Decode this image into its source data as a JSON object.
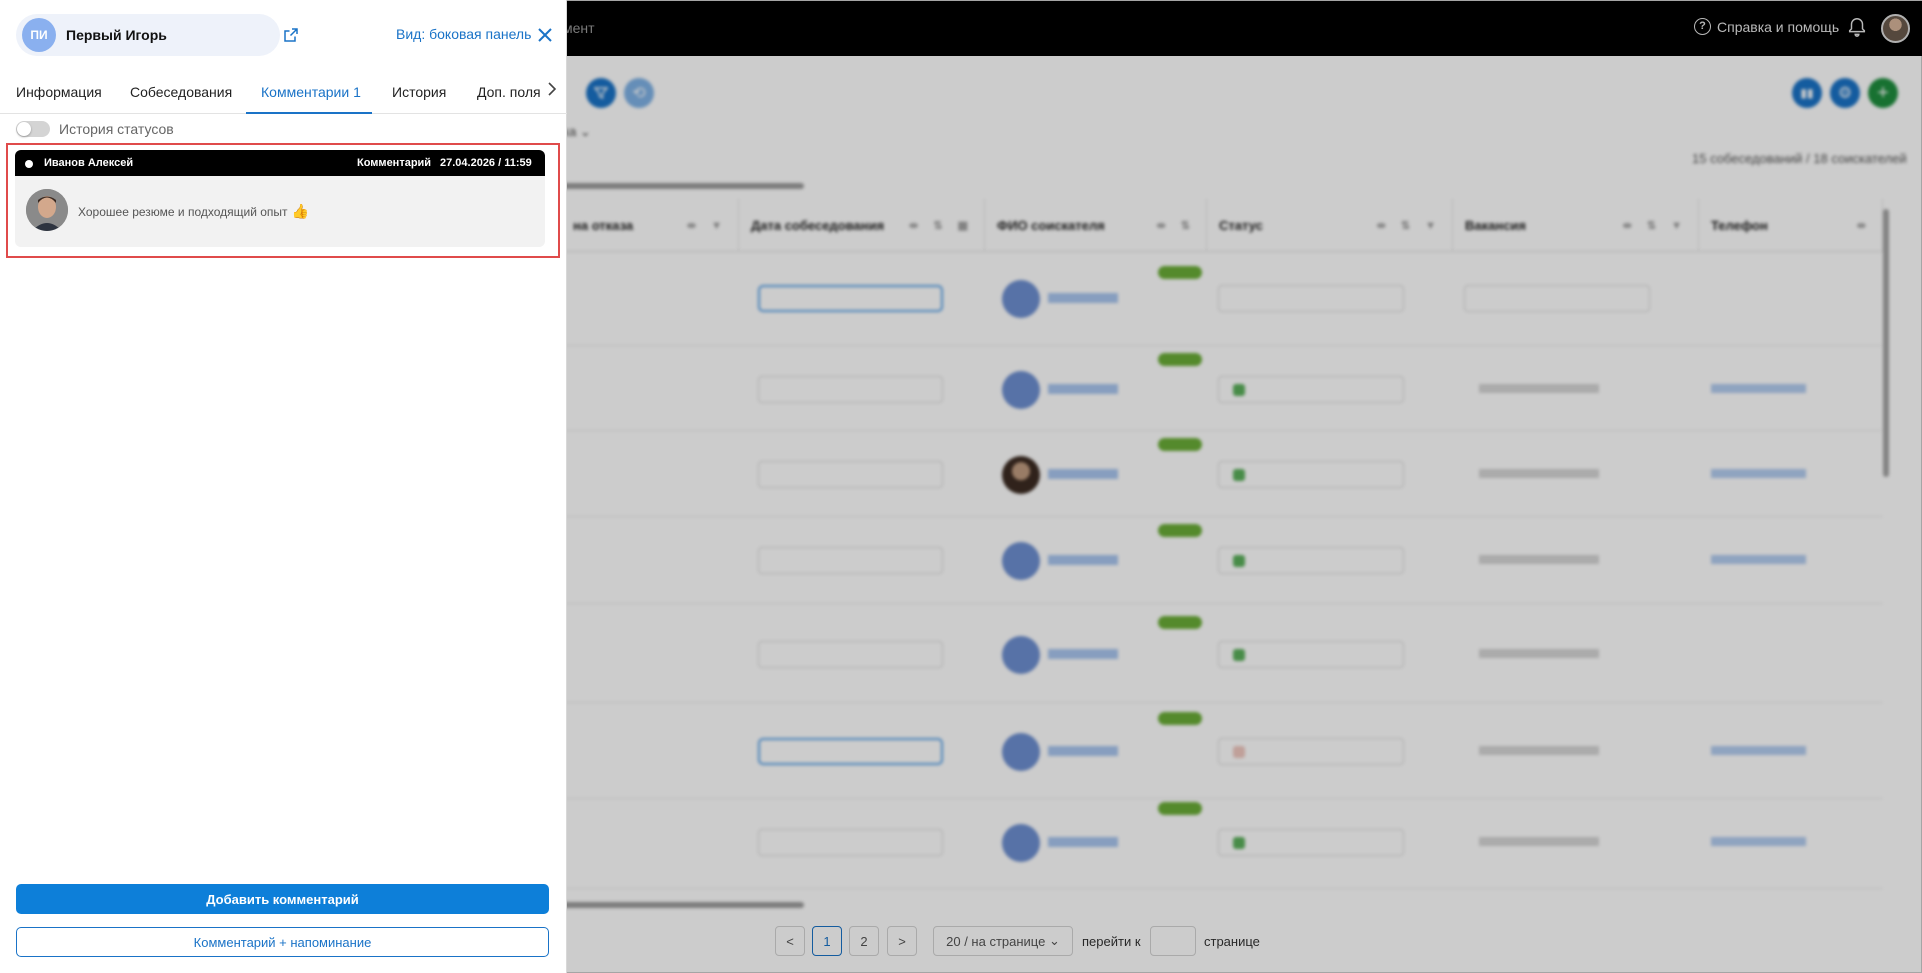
{
  "topbar": {
    "menu_fragment": "мент",
    "help_label": "Справка и помощь",
    "help_icon": "question-circle-icon",
    "bell_icon": "bell-icon"
  },
  "toolbar": {
    "filter_icon": "filter-icon",
    "history_icon": "history-icon",
    "stats_icon": "bar-chart-icon",
    "settings_icon": "gear-icon",
    "add_icon": "plus-icon",
    "accent_blue": "#1a73c7",
    "accent_green": "#1e8e3e"
  },
  "table": {
    "dropdown_fragment": "ка",
    "counts": "15 собеседований / 18 соискателей",
    "columns": [
      {
        "label": "на отказа"
      },
      {
        "label": "Дата собеседования"
      },
      {
        "label": "ФИО соискателя"
      },
      {
        "label": "Статус"
      },
      {
        "label": "Вакансия"
      },
      {
        "label": "Телефон"
      }
    ]
  },
  "pagination": {
    "prev": "<",
    "pages": [
      "1",
      "2"
    ],
    "next": ">",
    "per_page": "20 / на странице",
    "goto_label": "перейти к",
    "goto_suffix": "странице"
  },
  "panel": {
    "candidate_initials": "ПИ",
    "candidate_name": "Первый Игорь",
    "view_label": "Вид: боковая панель",
    "tabs": [
      {
        "label": "Информация"
      },
      {
        "label": "Собеседования"
      },
      {
        "label": "Комментарии 1"
      },
      {
        "label": "История"
      },
      {
        "label": "Доп. поля"
      }
    ],
    "active_tab": 2,
    "status_history_label": "История статусов",
    "comment": {
      "author": "Иванов Алексей",
      "type": "Комментарий",
      "date": "27.04.2026 / 11:59",
      "text": "Хорошее резюме и подходящий опыт",
      "emoji": "👍"
    },
    "add_comment_button": "Добавить комментарий",
    "comment_reminder_button": "Комментарий + напоминание"
  }
}
